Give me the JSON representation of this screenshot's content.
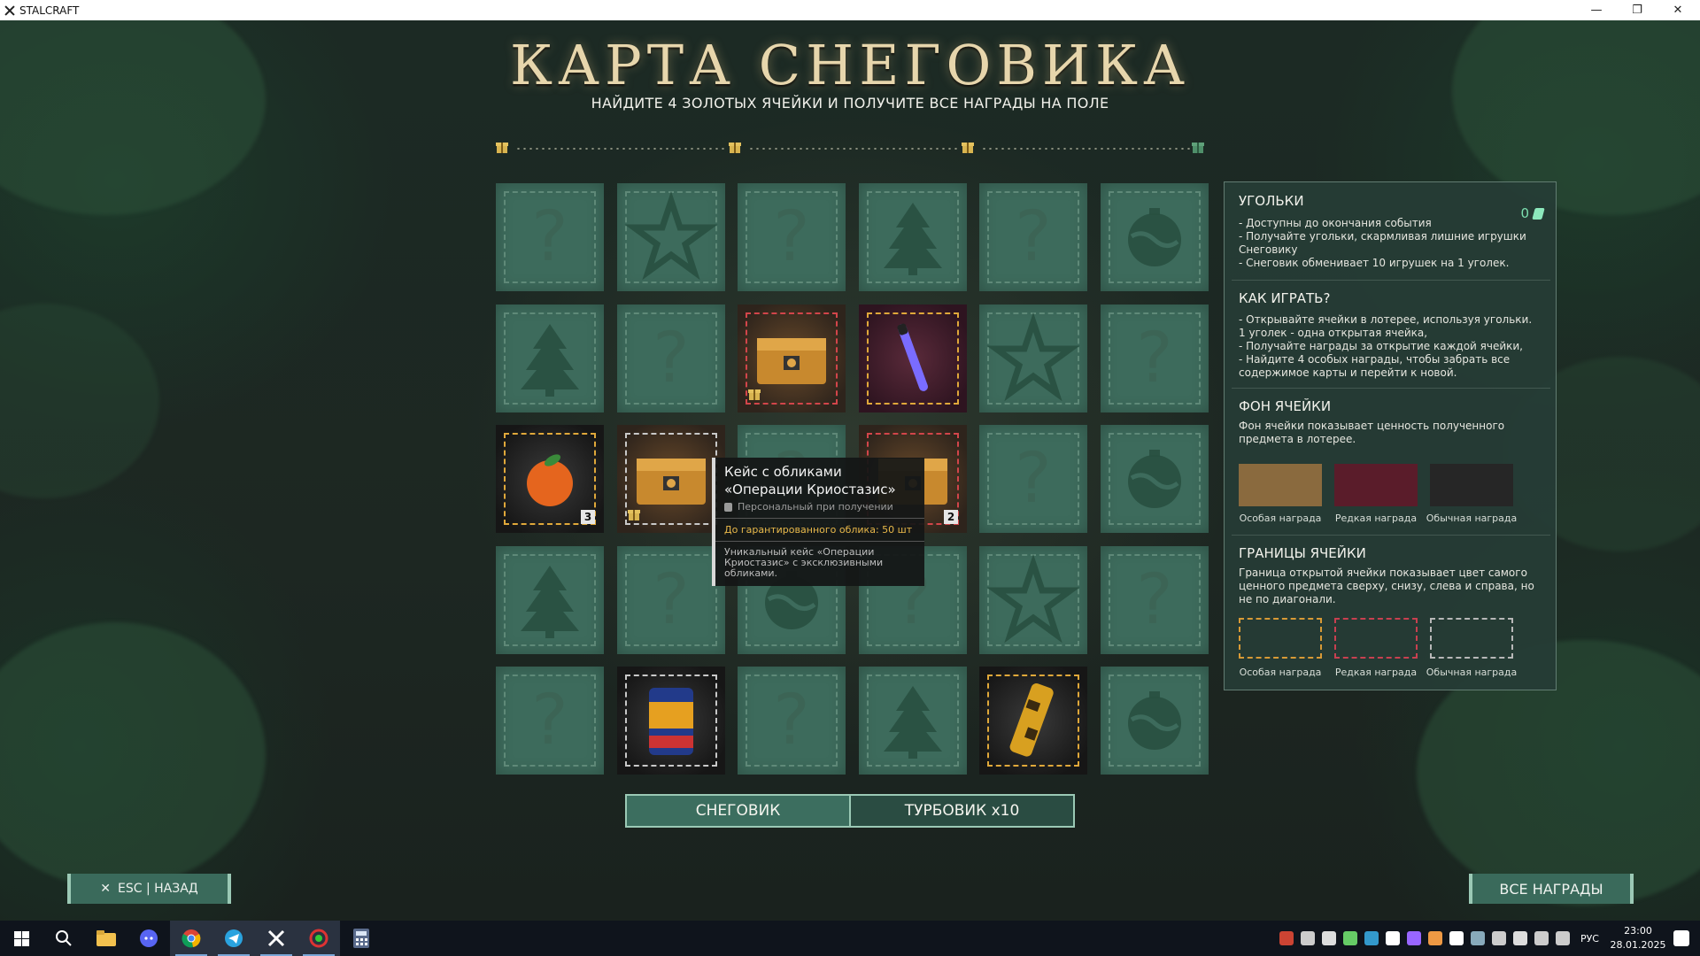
{
  "window": {
    "title": "STALCRAFT",
    "minimize": "—",
    "maximize": "❐",
    "close": "✕"
  },
  "header": {
    "title": "КАРТА СНЕГОВИКА",
    "subtitle": "НАЙДИТЕ 4 ЗОЛОТЫХ ЯЧЕЙКИ И ПОЛУЧИТЕ ВСЕ НАГРАДЫ НА ПОЛЕ"
  },
  "progress": {
    "milestones": [
      "gift-icon",
      "gift-icon",
      "gift-icon",
      "gift-icon"
    ],
    "final_color": "#4f8f6a"
  },
  "grid": {
    "rows": [
      [
        {
          "state": "closed",
          "icon": "question-icon"
        },
        {
          "state": "closed",
          "icon": "star-icon"
        },
        {
          "state": "closed",
          "icon": "question-icon"
        },
        {
          "state": "closed",
          "icon": "tree-icon"
        },
        {
          "state": "closed",
          "icon": "question-icon"
        },
        {
          "state": "closed",
          "icon": "ornament-icon"
        }
      ],
      [
        {
          "state": "closed",
          "icon": "tree-icon"
        },
        {
          "state": "closed",
          "icon": "question-icon"
        },
        {
          "state": "open",
          "item": "case-icon",
          "bg": "special",
          "border": "red",
          "gift": true
        },
        {
          "state": "open",
          "item": "glowstick-icon",
          "bg": "rare",
          "border": "gold"
        },
        {
          "state": "closed",
          "icon": "star-icon"
        },
        {
          "state": "closed",
          "icon": "question-icon"
        }
      ],
      [
        {
          "state": "open",
          "item": "tangerine-icon",
          "bg": "common",
          "border": "gold",
          "count": "3"
        },
        {
          "state": "open",
          "item": "case-icon",
          "bg": "special",
          "border": "white",
          "gift": true
        },
        {
          "state": "closed",
          "icon": "question-icon"
        },
        {
          "state": "open",
          "item": "case-icon",
          "bg": "special",
          "border": "red",
          "count": "2"
        },
        {
          "state": "closed",
          "icon": "question-icon"
        },
        {
          "state": "closed",
          "icon": "ornament-icon"
        }
      ],
      [
        {
          "state": "closed",
          "icon": "tree-icon"
        },
        {
          "state": "closed",
          "icon": "question-icon"
        },
        {
          "state": "closed",
          "icon": "ornament-icon"
        },
        {
          "state": "closed",
          "icon": "question-icon"
        },
        {
          "state": "closed",
          "icon": "star-icon"
        },
        {
          "state": "closed",
          "icon": "question-icon"
        }
      ],
      [
        {
          "state": "closed",
          "icon": "question-icon"
        },
        {
          "state": "open",
          "item": "beans-can-icon",
          "bg": "common",
          "border": "white"
        },
        {
          "state": "closed",
          "icon": "question-icon"
        },
        {
          "state": "closed",
          "icon": "tree-icon"
        },
        {
          "state": "open",
          "item": "camo-cylinder-icon",
          "bg": "common",
          "border": "gold"
        },
        {
          "state": "closed",
          "icon": "ornament-icon"
        }
      ]
    ]
  },
  "tooltip": {
    "title": "Кейс с обликами «Операции Криостазис»",
    "personal": "Персональный при получении",
    "guarantee": "До гарантированного облика: 50 шт",
    "description": "Уникальный кейс «Операции Криостазис» с эксклюзивными обликами."
  },
  "tabs": [
    {
      "label": "СНЕГОВИК",
      "active": true
    },
    {
      "label": "ТУРБОВИК x10",
      "active": false
    }
  ],
  "panel": {
    "coals": {
      "header": "УГОЛЬКИ",
      "count": "0",
      "lines": [
        "- Доступны до окончания события",
        "- Получайте угольки, скармливая лишние игрушки Снеговику",
        "- Снеговик обменивает 10 игрушек на 1 уголек."
      ]
    },
    "howto": {
      "header": "КАК ИГРАТЬ?",
      "lines": [
        "- Открывайте ячейки в лотерее, используя угольки.",
        "1 уголек - одна открытая ячейка,",
        "- Получайте награды за открытие каждой ячейки,",
        "- Найдите 4 особых награды, чтобы забрать все содержимое карты и перейти к новой."
      ]
    },
    "background": {
      "header": "ФОН ЯЧЕЙКИ",
      "text": "Фон ячейки показывает ценность полученного предмета в лотерее.",
      "swatches": [
        {
          "label": "Особая награда",
          "color": "#8a6a3e"
        },
        {
          "label": "Редкая награда",
          "color": "#5a1c2a"
        },
        {
          "label": "Обычная награда",
          "color": "#262626"
        }
      ]
    },
    "borders": {
      "header": "ГРАНИЦЫ ЯЧЕЙКИ",
      "text": "Граница открытой ячейки показывает цвет самого ценного предмета сверху, снизу, слева и справа, но не по диагонали.",
      "swatches": [
        {
          "label": "Особая награда",
          "color": "#d89a36"
        },
        {
          "label": "Редкая награда",
          "color": "#c84050"
        },
        {
          "label": "Обычная награда",
          "color": "#b8b8b8"
        }
      ]
    }
  },
  "buttons": {
    "back": "ESC | НАЗАД",
    "all_rewards": "ВСЕ НАГРАДЫ"
  },
  "taskbar": {
    "apps": [
      "windows-start-icon",
      "search-icon",
      "file-explorer-icon",
      "discord-icon",
      "chrome-icon",
      "telegram-icon",
      "stalcraft-icon",
      "exbo-launcher-icon",
      "calculator-icon"
    ],
    "lang": "РУС",
    "time": "23:00",
    "date": "28.01.2025"
  }
}
